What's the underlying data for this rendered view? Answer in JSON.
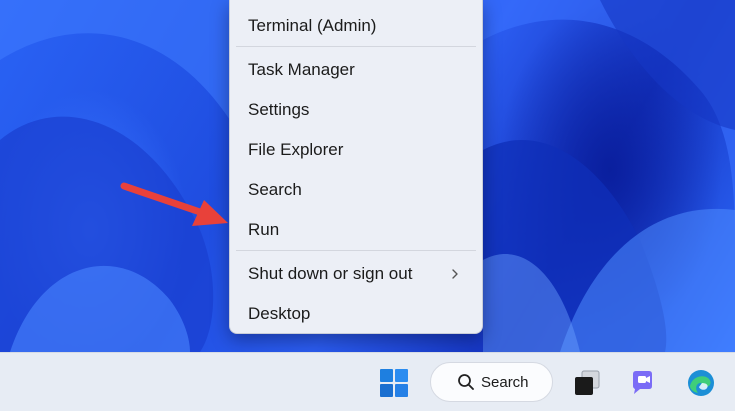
{
  "context_menu": {
    "items": [
      {
        "label": "Terminal (Admin)"
      },
      {
        "label": "Task Manager"
      },
      {
        "label": "Settings"
      },
      {
        "label": "File Explorer"
      },
      {
        "label": "Search"
      },
      {
        "label": "Run"
      },
      {
        "label": "Shut down or sign out",
        "submenu": true
      },
      {
        "label": "Desktop"
      }
    ]
  },
  "annotation": {
    "arrow_color": "#e8413a",
    "points_to": "Run"
  },
  "taskbar": {
    "search_label": "Search",
    "icons": [
      "windows-start-icon",
      "search-icon",
      "task-view-icon",
      "teams-chat-icon",
      "edge-icon"
    ]
  },
  "colors": {
    "menu_bg": "#eceff6",
    "taskbar_bg": "#e7ecf4",
    "wallpaper_blue": "#1f4de0"
  }
}
